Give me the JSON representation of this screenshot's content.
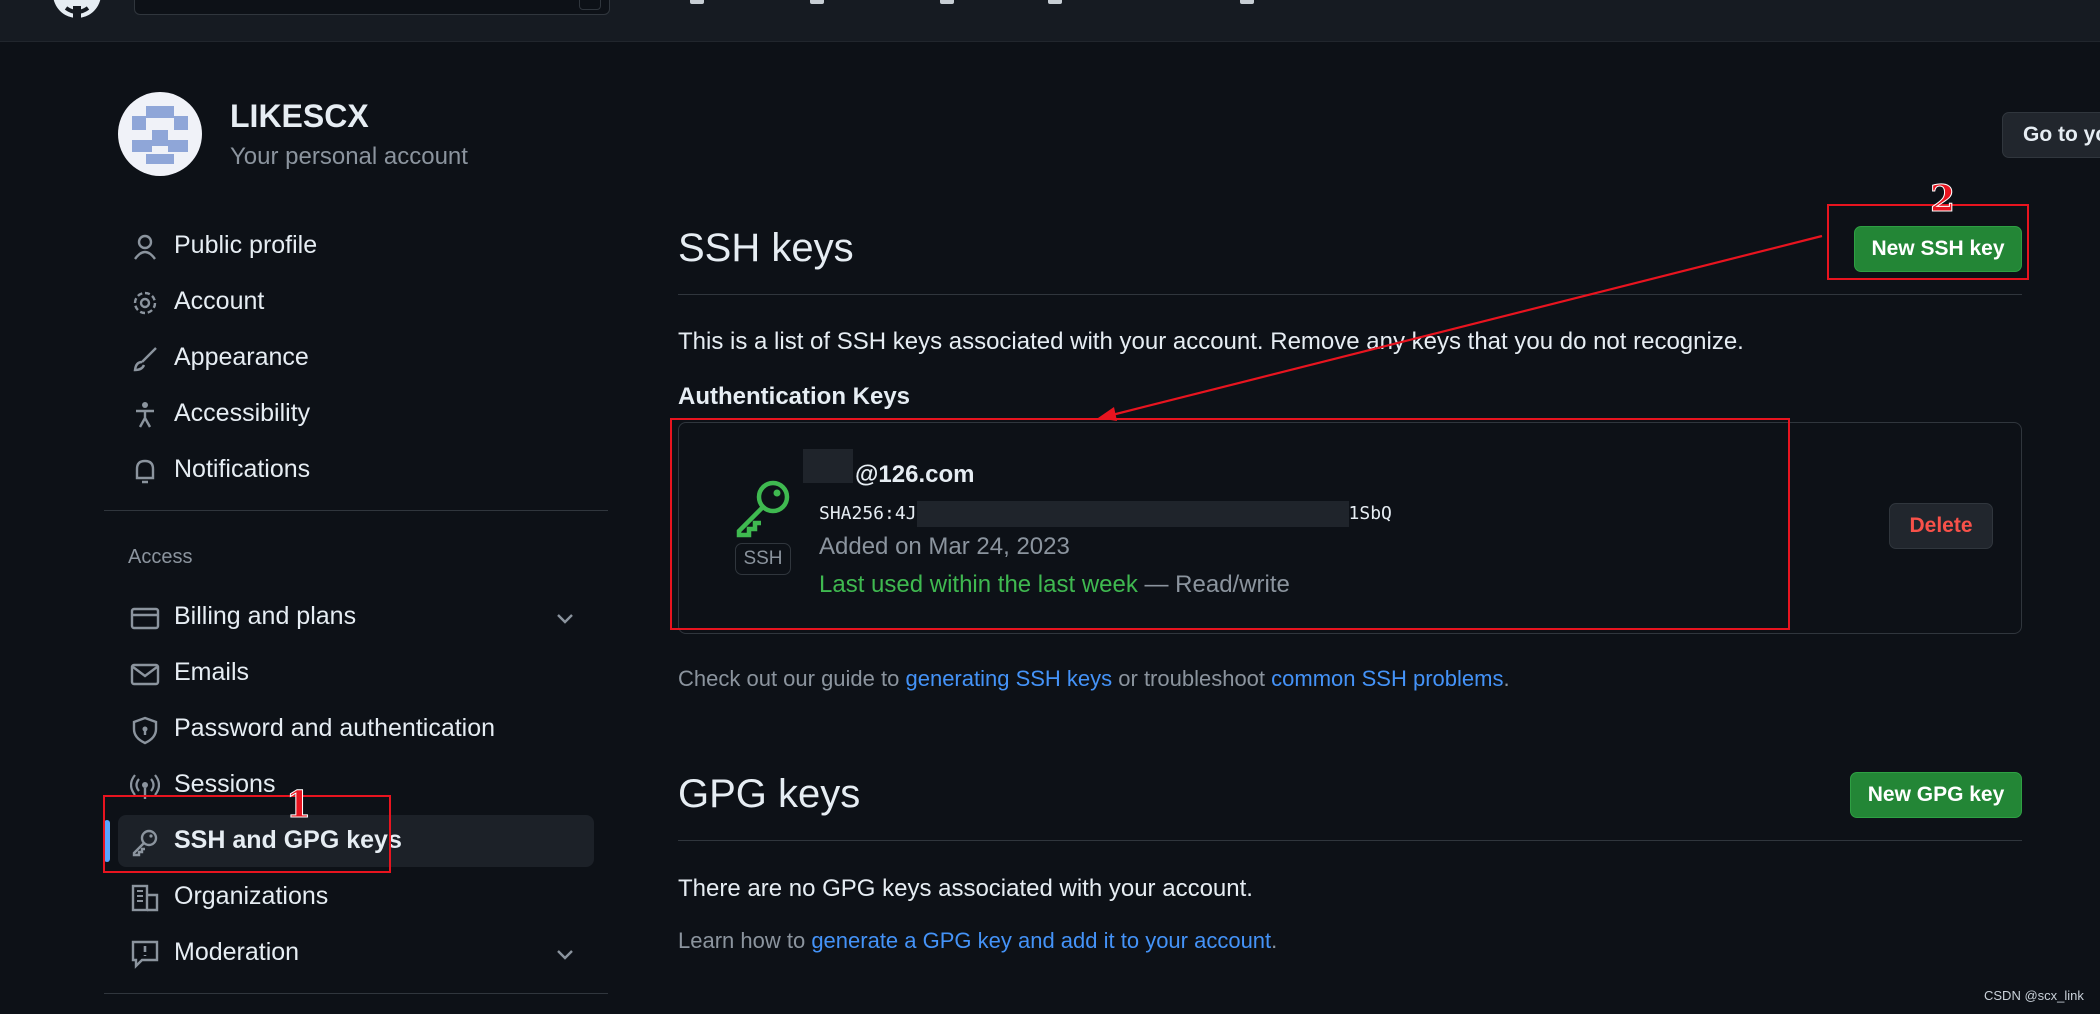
{
  "profile": {
    "username": "LIKESCX",
    "subtitle": "Your personal account",
    "goto_button": "Go to yo"
  },
  "sidebar": {
    "items": [
      {
        "label": "Public profile",
        "icon": "person-icon"
      },
      {
        "label": "Account",
        "icon": "gear-icon"
      },
      {
        "label": "Appearance",
        "icon": "paintbrush-icon"
      },
      {
        "label": "Accessibility",
        "icon": "accessibility-icon"
      },
      {
        "label": "Notifications",
        "icon": "bell-icon"
      }
    ],
    "access_heading": "Access",
    "access_items": [
      {
        "label": "Billing and plans",
        "icon": "credit-card-icon",
        "expandable": true
      },
      {
        "label": "Emails",
        "icon": "mail-icon"
      },
      {
        "label": "Password and authentication",
        "icon": "shield-lock-icon"
      },
      {
        "label": "Sessions",
        "icon": "broadcast-icon"
      },
      {
        "label": "SSH and GPG keys",
        "icon": "key-icon",
        "active": true
      },
      {
        "label": "Organizations",
        "icon": "organization-icon"
      },
      {
        "label": "Moderation",
        "icon": "report-icon",
        "expandable": true
      }
    ]
  },
  "ssh": {
    "title": "SSH keys",
    "new_button": "New SSH key",
    "description": "This is a list of SSH keys associated with your account. Remove any keys that you do not recognize.",
    "auth_heading": "Authentication Keys",
    "key": {
      "title": "@126.com",
      "badge": "SSH",
      "fingerprint_start": "SHA256:4J",
      "fingerprint_end": "1SbQ",
      "added": "Added on Mar 24, 2023",
      "last_used": "Last used within the last week",
      "access": "— Read/write",
      "delete_button": "Delete"
    },
    "guide_prefix": "Check out our guide to ",
    "guide_link1": "generating SSH keys",
    "guide_middle": " or troubleshoot ",
    "guide_link2": "common SSH problems",
    "guide_suffix": "."
  },
  "gpg": {
    "title": "GPG keys",
    "new_button": "New GPG key",
    "empty": "There are no GPG keys associated with your account.",
    "learn_prefix": "Learn how to ",
    "learn_link": "generate a GPG key and add it to your account",
    "learn_suffix": "."
  },
  "annotations": {
    "step1": "1",
    "step2": "2",
    "color": "#e8141f"
  },
  "watermark": "CSDN @scx_link",
  "colors": {
    "background": "#0d1117",
    "accent_green": "#238636",
    "link_blue": "#4493f8",
    "danger_red": "#f85149",
    "active_indicator": "#58a6ff"
  }
}
